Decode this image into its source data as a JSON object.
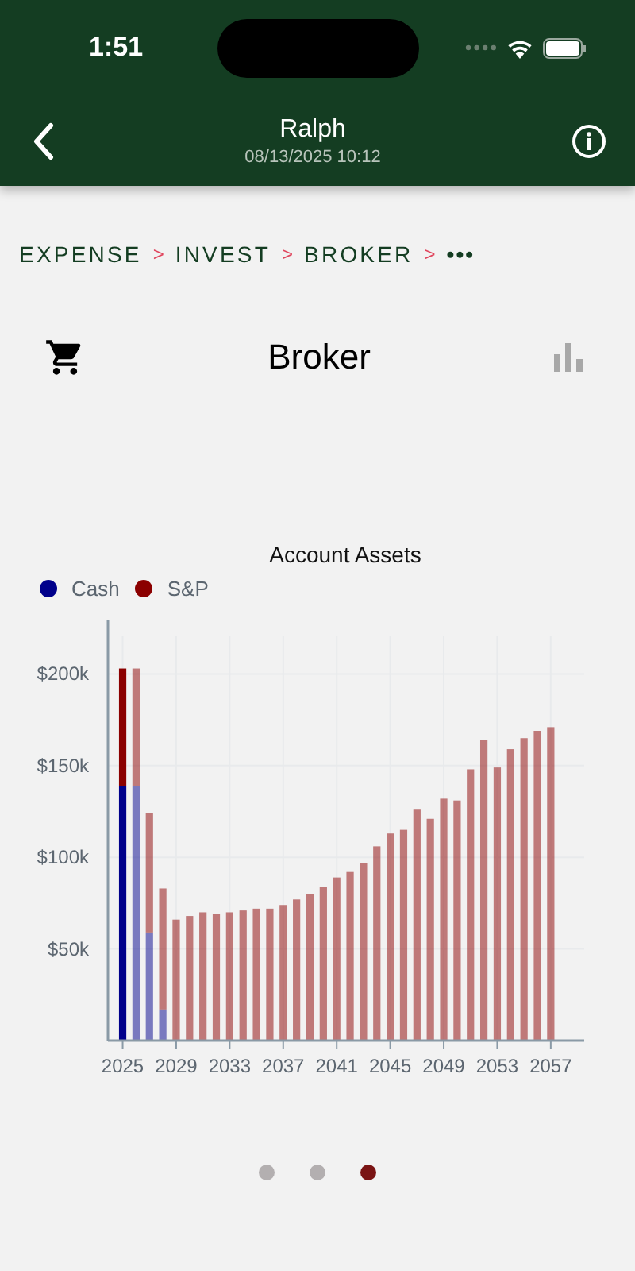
{
  "status_bar": {
    "time": "1:51"
  },
  "nav": {
    "title": "Ralph",
    "subtitle": "08/13/2025 10:12"
  },
  "breadcrumb": {
    "items": [
      {
        "label": "EXPENSE",
        "separator": ">"
      },
      {
        "label": "INVEST",
        "separator": ">"
      },
      {
        "label": "BROKER",
        "separator": ">"
      }
    ],
    "more": "•••"
  },
  "header": {
    "title": "Broker"
  },
  "chart": {
    "chart_data": {
      "type": "bar",
      "stacked": true,
      "grid": true,
      "title": "Account Assets",
      "x": [
        2025,
        2026,
        2027,
        2028,
        2029,
        2030,
        2031,
        2032,
        2033,
        2034,
        2035,
        2036,
        2037,
        2038,
        2039,
        2040,
        2041,
        2042,
        2043,
        2044,
        2045,
        2046,
        2047,
        2048,
        2049,
        2050,
        2051,
        2052,
        2053,
        2054,
        2055,
        2056,
        2057
      ],
      "series": [
        {
          "name": "Cash",
          "color": "#00008b",
          "values": [
            139,
            139,
            59,
            17,
            0,
            0,
            0,
            0,
            0,
            0,
            0,
            0,
            0,
            0,
            0,
            0,
            0,
            0,
            0,
            0,
            0,
            0,
            0,
            0,
            0,
            0,
            0,
            0,
            0,
            0,
            0,
            0,
            0
          ]
        },
        {
          "name": "S&P",
          "color": "#8b0000",
          "values": [
            64,
            64,
            65,
            66,
            66,
            68,
            70,
            69,
            70,
            71,
            72,
            72,
            74,
            77,
            80,
            84,
            89,
            92,
            97,
            106,
            113,
            115,
            126,
            121,
            132,
            131,
            148,
            164,
            149,
            159,
            165,
            169,
            171
          ]
        }
      ],
      "xlim": [
        2023.9,
        2059.5
      ],
      "ylim": [
        0,
        221
      ],
      "yticks": [
        {
          "value": 50,
          "label": "$50k"
        },
        {
          "value": 100,
          "label": "$100k"
        },
        {
          "value": 150,
          "label": "$150k"
        },
        {
          "value": 200,
          "label": "$200k"
        }
      ],
      "xticks": [
        2025,
        2029,
        2033,
        2037,
        2041,
        2045,
        2049,
        2053,
        2057
      ]
    }
  },
  "pager": [
    {
      "selected": false
    },
    {
      "selected": false
    },
    {
      "selected": true
    }
  ]
}
